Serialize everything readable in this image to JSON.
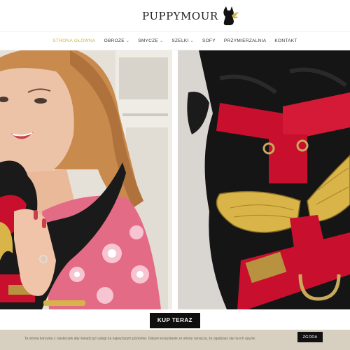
{
  "logo": {
    "text": "PUPPYMOUR"
  },
  "nav": {
    "items": [
      {
        "label": "STRONA GŁÓWNA",
        "active": true,
        "dropdown": false
      },
      {
        "label": "OBROŻE",
        "active": false,
        "dropdown": true
      },
      {
        "label": "SMYCZE",
        "active": false,
        "dropdown": true
      },
      {
        "label": "SZELKI",
        "active": false,
        "dropdown": true
      },
      {
        "label": "SOFY",
        "active": false,
        "dropdown": false
      },
      {
        "label": "PRZYMIERZALNIA",
        "active": false,
        "dropdown": false
      },
      {
        "label": "KONTAKT",
        "active": false,
        "dropdown": false
      }
    ]
  },
  "cta": {
    "label": "KUP TERAZ"
  },
  "cookie": {
    "text": "Ta strona korzysta z ciasteczek aby świadczyć usługi na najwyższym poziomie. Dalsze korzystanie ze strony oznacza, że zgadzasz się na ich użycie.",
    "accept_label": "ZGODA"
  },
  "colors": {
    "accent": "#c9b24a",
    "harness_red": "#c8102e",
    "cookie_bar": "#d7cfbf",
    "cta_bg": "#0f0f0f"
  }
}
